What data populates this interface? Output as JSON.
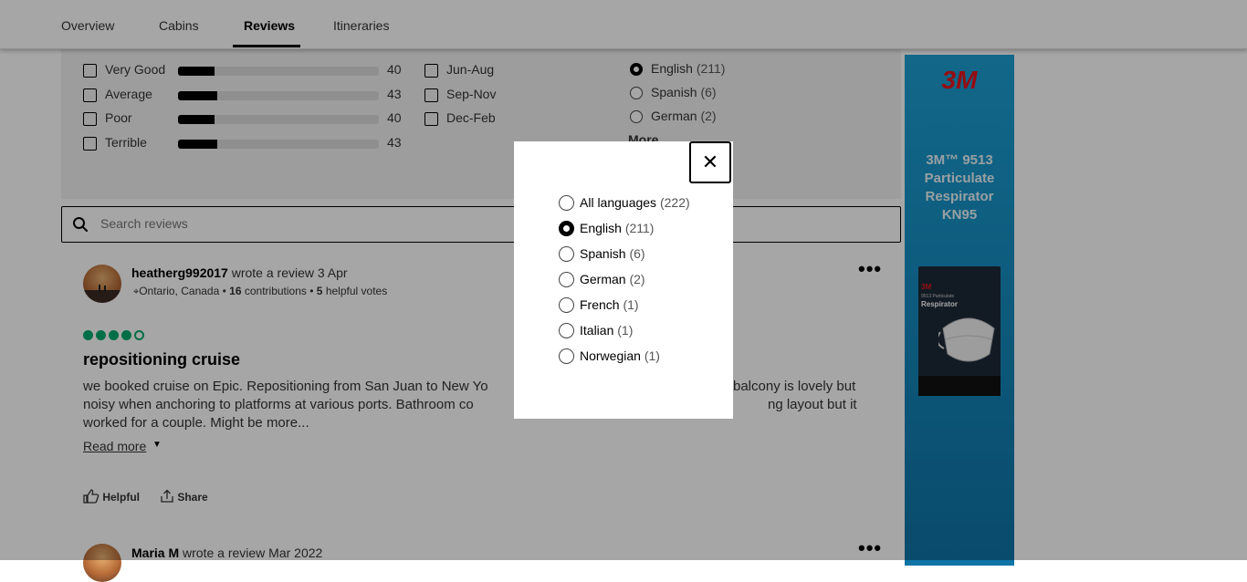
{
  "nav": {
    "tabs": [
      {
        "label": "Overview"
      },
      {
        "label": "Cabins"
      },
      {
        "label": "Reviews"
      },
      {
        "label": "Itineraries"
      }
    ],
    "active": "Reviews"
  },
  "filters": {
    "traveler_rating": [
      {
        "label": "Very Good",
        "count": "40",
        "pct": 0.18
      },
      {
        "label": "Average",
        "count": "43",
        "pct": 0.195
      },
      {
        "label": "Poor",
        "count": "40",
        "pct": 0.18
      },
      {
        "label": "Terrible",
        "count": "43",
        "pct": 0.195
      }
    ],
    "time_of_year": [
      {
        "label": "Jun-Aug"
      },
      {
        "label": "Sep-Nov"
      },
      {
        "label": "Dec-Feb"
      }
    ],
    "language": [
      {
        "label": "English",
        "count": "(211)",
        "checked": true
      },
      {
        "label": "Spanish",
        "count": "(6)",
        "checked": false
      },
      {
        "label": "German",
        "count": "(2)",
        "checked": false
      }
    ],
    "more_label": "More"
  },
  "search": {
    "placeholder": "Search reviews"
  },
  "review": {
    "username": "heatherg992017",
    "meta": "wrote a review 3 Apr",
    "location": "Ontario, Canada",
    "contributions": "16",
    "contributions_label": "contributions",
    "helpful_count": "5",
    "helpful_label": "helpful votes",
    "rating": 4,
    "title": "repositioning cruise",
    "body_line1": "we booked cruise on Epic. Repositioning from San Juan to New Yo",
    "body_line1_right": "balcony is lovely but",
    "body_line2": "noisy when anchoring to platforms at various ports. Bathroom co",
    "body_line2_right": "ng layout but it",
    "body_line3": "worked for a couple. Might be more...",
    "read_more": "Read more",
    "helpful_btn": "Helpful",
    "share_btn": "Share"
  },
  "review2": {
    "username": "Maria M",
    "meta": "wrote a review Mar 2022"
  },
  "ad": {
    "brand": "3M",
    "title": "3M™ 9513 Particulate Respirator KN95",
    "pack_brand": "3M",
    "pack_sub": "9513 Particulate",
    "pack_name": "Respirator"
  },
  "modal": {
    "options": [
      {
        "label": "All languages",
        "count": "(222)",
        "checked": false
      },
      {
        "label": "English",
        "count": "(211)",
        "checked": true
      },
      {
        "label": "Spanish",
        "count": "(6)",
        "checked": false
      },
      {
        "label": "German",
        "count": "(2)",
        "checked": false
      },
      {
        "label": "French",
        "count": "(1)",
        "checked": false
      },
      {
        "label": "Italian",
        "count": "(1)",
        "checked": false
      },
      {
        "label": "Norwegian",
        "count": "(1)",
        "checked": false
      }
    ],
    "close_symbol": "✕"
  }
}
